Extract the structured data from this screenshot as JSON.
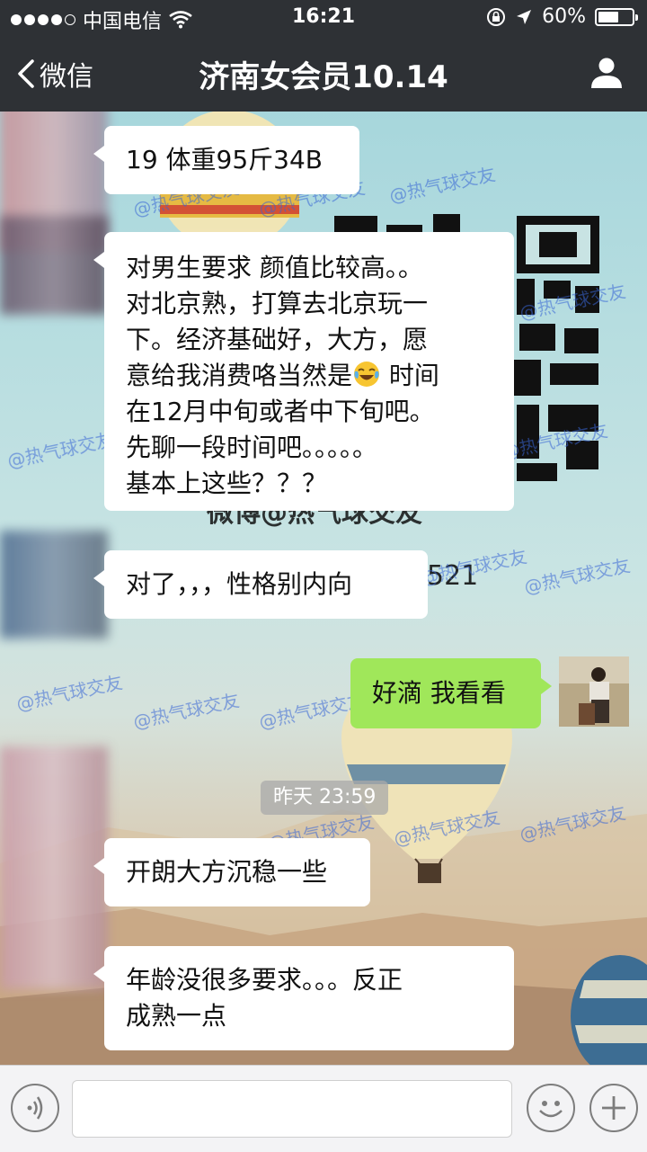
{
  "status_bar": {
    "carrier": "中国电信",
    "time": "16:21",
    "battery_text": "60%",
    "battery_level": 0.6
  },
  "nav": {
    "back_label": "微信",
    "title": "济南女会员10.14"
  },
  "messages": [
    {
      "side": "in",
      "text": "19 体重95斤34B"
    },
    {
      "side": "in",
      "text_before_emoji": "对男生要求 颜值比较高。。\n对北京熟，打算去北京玩一\n下。经济基础好，大方，愿\n意给我消费咯当然是",
      "text_after_emoji": " 时间\n在12月中旬或者中下旬吧。\n先聊一段时间吧。。。。。\n基本上这些？？？"
    },
    {
      "side": "in",
      "text": "对了，，，性格别内向"
    },
    {
      "side": "out",
      "text": "好滴 我看看"
    },
    {
      "side": "in",
      "text": "开朗大方沉稳一些"
    },
    {
      "side": "in",
      "text": "年龄没很多要求。。。反正\n成熟一点"
    }
  ],
  "timestamp": "昨天 23:59",
  "background": {
    "watermark_text": "@热气球交友",
    "number_fragment": "521"
  },
  "colors": {
    "bar_dark": "#2e3135",
    "bubble_out": "#a0e75a",
    "bubble_in": "#ffffff"
  }
}
